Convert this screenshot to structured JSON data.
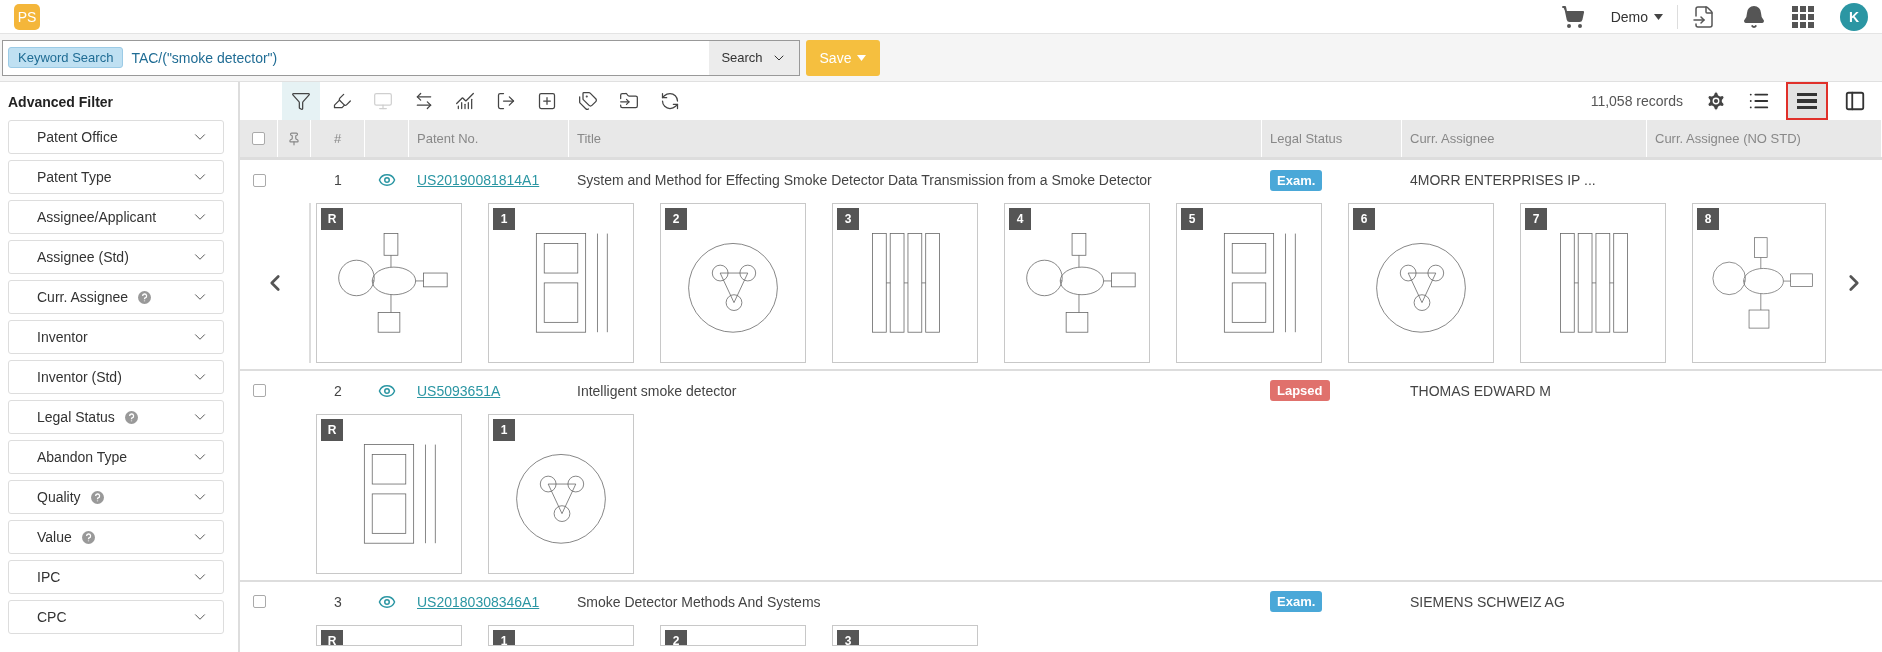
{
  "header": {
    "logo": "PS",
    "account": "Demo",
    "avatar": "K"
  },
  "search": {
    "tag": "Keyword Search",
    "value": "TAC/(\"smoke detector\")",
    "search_button": "Search",
    "save_button": "Save"
  },
  "sidebar": {
    "title": "Advanced Filter",
    "filters": [
      {
        "label": "Patent Office",
        "help": false
      },
      {
        "label": "Patent Type",
        "help": false
      },
      {
        "label": "Assignee/Applicant",
        "help": false
      },
      {
        "label": "Assignee (Std)",
        "help": false
      },
      {
        "label": "Curr. Assignee",
        "help": true
      },
      {
        "label": "Inventor",
        "help": false
      },
      {
        "label": "Inventor (Std)",
        "help": false
      },
      {
        "label": "Legal Status",
        "help": true
      },
      {
        "label": "Abandon Type",
        "help": false
      },
      {
        "label": "Quality",
        "help": true
      },
      {
        "label": "Value",
        "help": true
      },
      {
        "label": "IPC",
        "help": false
      },
      {
        "label": "CPC",
        "help": false
      }
    ]
  },
  "toolbar": {
    "tools": [
      {
        "kind": "filter",
        "selected": true,
        "disabled": false
      },
      {
        "kind": "highlighter",
        "selected": false,
        "disabled": false
      },
      {
        "kind": "monitor",
        "selected": false,
        "disabled": true
      },
      {
        "kind": "compare",
        "selected": false,
        "disabled": false
      },
      {
        "kind": "chart",
        "selected": false,
        "disabled": false
      },
      {
        "kind": "export",
        "selected": false,
        "disabled": false
      },
      {
        "kind": "add",
        "selected": false,
        "disabled": false
      },
      {
        "kind": "tag",
        "selected": false,
        "disabled": false
      },
      {
        "kind": "folder",
        "selected": false,
        "disabled": false
      },
      {
        "kind": "sync",
        "selected": false,
        "disabled": false
      }
    ],
    "records": "11,058 records",
    "views": [
      {
        "kind": "list",
        "selected": false
      },
      {
        "kind": "rows",
        "selected": true
      },
      {
        "kind": "split",
        "selected": false
      }
    ]
  },
  "table": {
    "all_checked": false,
    "columns": [
      "#",
      "Patent No.",
      "Title",
      "Legal Status",
      "Curr. Assignee",
      "Curr. Assignee (NO STD)"
    ],
    "rows": [
      {
        "checked": false,
        "number": "1",
        "patent_no": "US20190081814A1",
        "title": "System and Method for Effecting Smoke Detector Data Transmission from a Smoke Detector",
        "legal_status": "Exam.",
        "color": "#4aa8d8",
        "assignee": "4MORR ENTERPRISES IP ...",
        "arrows": true,
        "figures": [
          "R",
          "1",
          "2",
          "3",
          "4",
          "5",
          "6",
          "7",
          "8"
        ]
      },
      {
        "checked": false,
        "number": "2",
        "patent_no": "US5093651A",
        "title": "Intelligent smoke detector",
        "legal_status": "Lapsed",
        "color": "#e0716c",
        "assignee": "THOMAS EDWARD M",
        "arrows": false,
        "figures": [
          "R",
          "1"
        ]
      },
      {
        "checked": false,
        "number": "3",
        "patent_no": "US20180308346A1",
        "title": "Smoke Detector Methods And Systems",
        "legal_status": "Exam.",
        "color": "#4aa8d8",
        "assignee": "SIEMENS SCHWEIZ AG",
        "arrows": false,
        "figures": [
          "R",
          "1",
          "2",
          "3"
        ]
      }
    ]
  }
}
